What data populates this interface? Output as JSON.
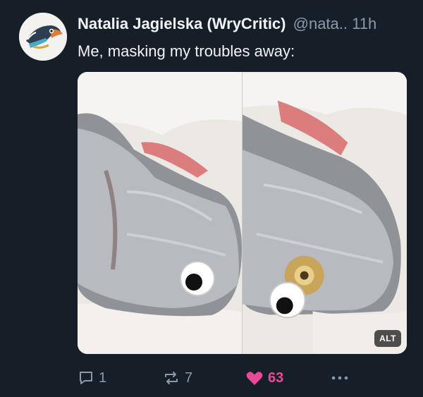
{
  "post": {
    "author_name": "Natalia Jagielska (WryCritic)",
    "author_handle": "@nata..",
    "time": "11h",
    "text": "Me, masking my troubles away:",
    "alt_badge": "ALT"
  },
  "actions": {
    "reply_count": "1",
    "repost_count": "7",
    "like_count": "63"
  },
  "colors": {
    "background": "#161e27",
    "text_primary": "#f1f3f5",
    "text_secondary": "#8d99a8",
    "like_accent": "#ec4899"
  },
  "icons": {
    "reply": "speech-bubble-icon",
    "repost": "repost-arrows-icon",
    "like": "heart-icon",
    "more": "ellipsis-icon"
  }
}
